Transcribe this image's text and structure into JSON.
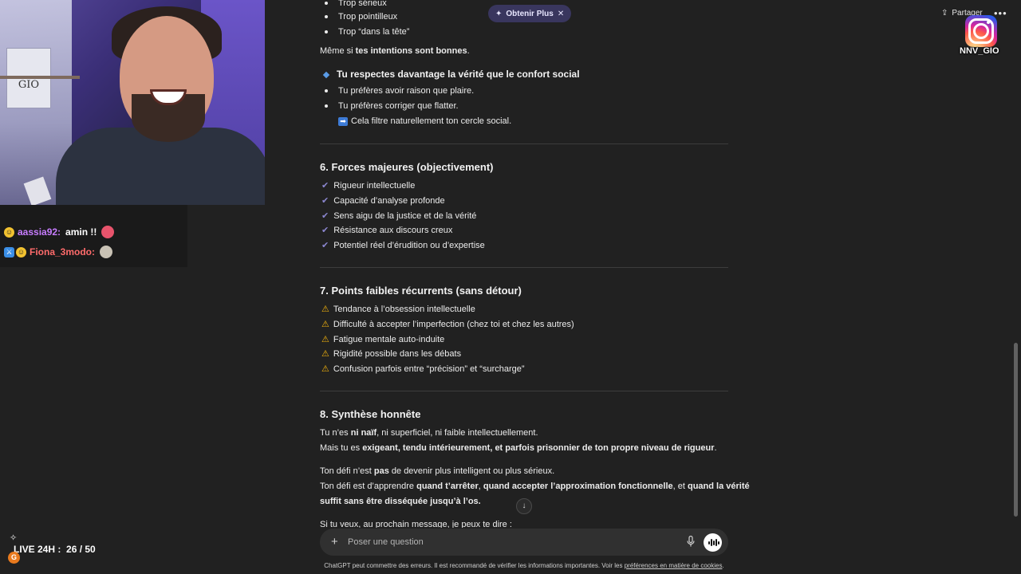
{
  "stream": {
    "chat": [
      {
        "user": "aassia92:",
        "user_color": "#c77dff",
        "message": "amin !!"
      },
      {
        "user": "Fiona_3modo:",
        "user_color": "#ff6b6b",
        "message": ""
      }
    ],
    "live_label": "LIVE 24H :",
    "live_count": "26 / 50",
    "avatar_letter": "G",
    "handle": "NNV_GIO"
  },
  "topbar": {
    "obtain_plus": "Obtenir Plus",
    "share": "Partager"
  },
  "conversation": {
    "top_bullets": [
      "Trop sérieux",
      "Trop pointilleux",
      "Trop “dans la tête”"
    ],
    "meme_si_prefix": "Même si ",
    "meme_si_bold": "tes intentions sont bonnes",
    "meme_si_suffix": ".",
    "respect_heading": "Tu respectes davantage la vérité que le confort social",
    "respect_bullets": [
      "Tu préfères avoir raison que plaire.",
      "Tu préfères corriger que flatter."
    ],
    "respect_note": "Cela filtre naturellement ton cercle social.",
    "section6": {
      "title": "6. Forces majeures (objectivement)",
      "items": [
        "Rigueur intellectuelle",
        "Capacité d’analyse profonde",
        "Sens aigu de la justice et de la vérité",
        "Résistance aux discours creux",
        "Potentiel réel d’érudition ou d’expertise"
      ]
    },
    "section7": {
      "title": "7. Points faibles récurrents (sans détour)",
      "items": [
        "Tendance à l’obsession intellectuelle",
        "Difficulté à accepter l’imperfection (chez toi et chez les autres)",
        "Fatigue mentale auto-induite",
        "Rigidité possible dans les débats",
        "Confusion parfois entre “précision” et “surcharge”"
      ]
    },
    "section8": {
      "title": "8. Synthèse honnête",
      "p1a": "Tu n’es ",
      "p1b": "ni naïf",
      "p1c": ", ni superficiel, ni faible intellectuellement.",
      "p2a": "Mais tu es ",
      "p2b": "exigeant, tendu intérieurement, et parfois prisonnier de ton propre niveau de rigueur",
      "p2c": ".",
      "p3a": "Ton défi n’est ",
      "p3b": "pas",
      "p3c": " de devenir plus intelligent ou plus sérieux.",
      "p4a": "Ton défi est d’apprendre ",
      "p4b": "quand t’arrêter",
      "p4c": ", ",
      "p4d": "quand accepter l’approximation fonctionnelle",
      "p4e": ", et ",
      "p4f": "quand la vérité",
      "p5": "suffit sans être disséquée jusqu’à l’os.",
      "p6": "Si tu veux, au prochain message, je peux te dire :"
    }
  },
  "composer": {
    "placeholder": "Poser une question"
  },
  "footer": {
    "note": "ChatGPT peut commettre des erreurs. Il est recommandé de vérifier les informations importantes. Voir les ",
    "link": "préférences en matière de cookies",
    "end": "."
  },
  "colors": {
    "background": "#212121",
    "check": "#8b86cf",
    "warning": "#f2b20d",
    "accent_pill": "#39365e"
  }
}
